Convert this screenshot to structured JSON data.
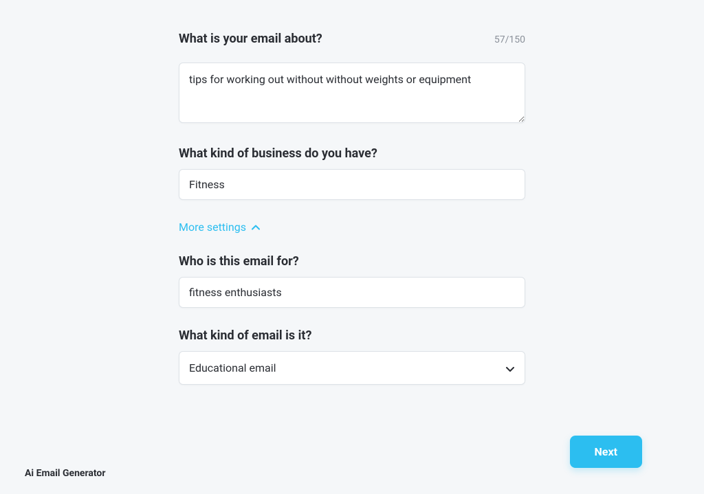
{
  "fields": {
    "email_about": {
      "label": "What is your email about?",
      "value": "tips for working out without without weights or equipment",
      "char_count": "57/150"
    },
    "business_kind": {
      "label": "What kind of business do you have?",
      "value": "Fitness"
    },
    "more_settings": {
      "label": "More settings"
    },
    "email_for": {
      "label": "Who is this email for?",
      "value": "fitness enthusiasts"
    },
    "email_kind": {
      "label": "What kind of email is it?",
      "value": "Educational email"
    }
  },
  "next_button": "Next",
  "footer": "Ai Email Generator"
}
